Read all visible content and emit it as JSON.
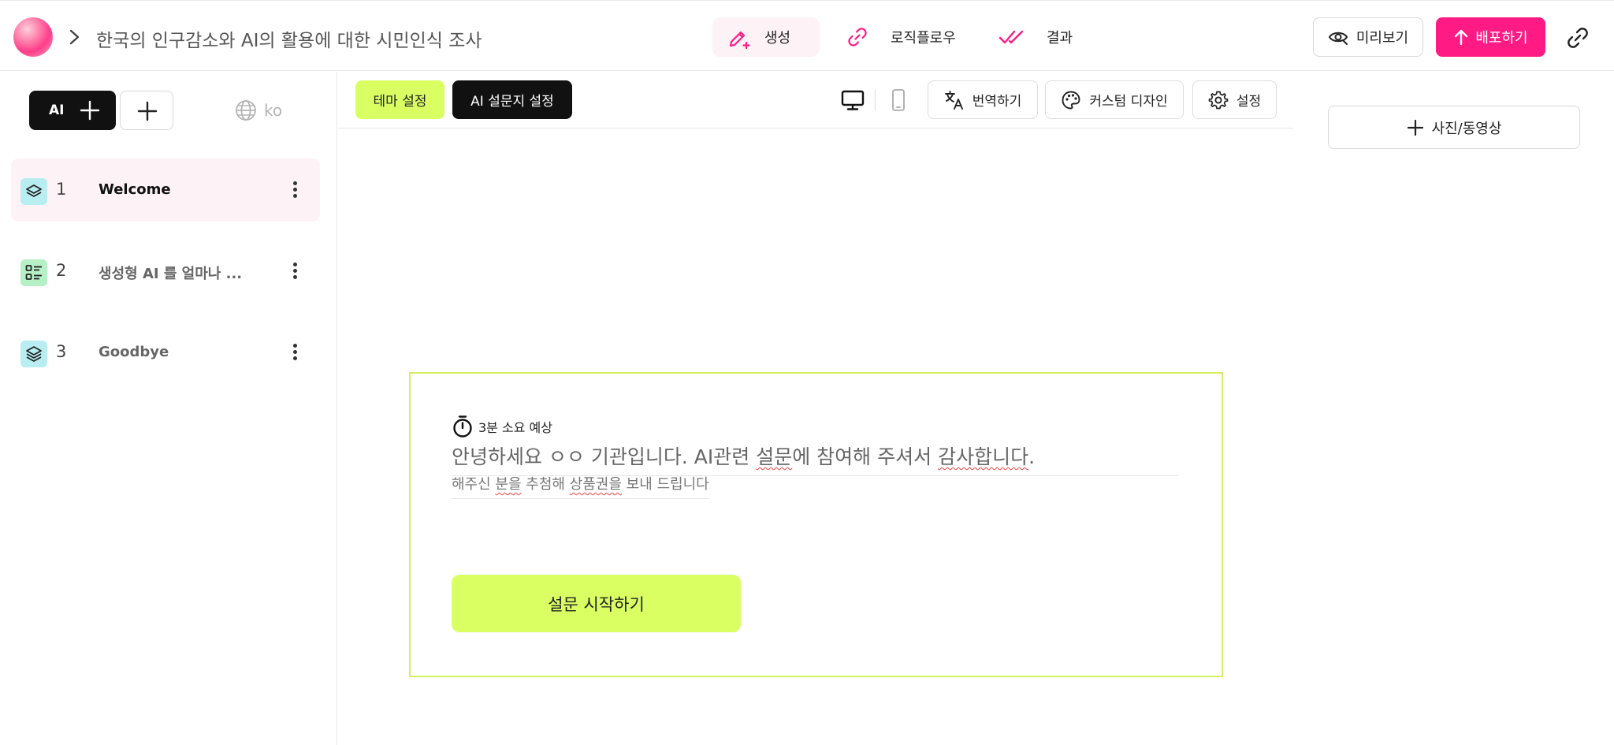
{
  "header": {
    "document_title": "한국의 인구감소와 AI의 활용에 대한 시민인식 조사",
    "tabs": [
      {
        "label": "생성",
        "icon": "pen-plus-icon",
        "active": true
      },
      {
        "label": "로직플로우",
        "icon": "link-icon",
        "active": false
      },
      {
        "label": "결과",
        "icon": "double-check-icon",
        "active": false
      }
    ],
    "preview_label": "미리보기",
    "deploy_label": "배포하기",
    "accent_color": "#ff1a84"
  },
  "sidebar": {
    "ai_add_label": "AI",
    "language": "ko",
    "pages": [
      {
        "number": "1",
        "label": "Welcome",
        "icon": "layers-icon",
        "active": true
      },
      {
        "number": "2",
        "label": "생성형 AI 를 얼마나 ...",
        "icon": "list-icon",
        "active": false
      },
      {
        "number": "3",
        "label": "Goodbye",
        "icon": "layers-stack-icon",
        "active": false
      }
    ]
  },
  "toolbar": {
    "theme_label": "테마 설정",
    "ai_settings_label": "AI 설문지 설정",
    "translate_label": "번역하기",
    "custom_design_label": "커스텀 디자인",
    "settings_label": "설정",
    "theme_color": "#d9ff63"
  },
  "canvas": {
    "estimate": "3분 소요 예상",
    "title_parts": [
      "안녕하세요 ㅇㅇ 기관입니다. AI관련 ",
      "설문",
      "에 참여해 주셔서 ",
      "감사합니다",
      "."
    ],
    "subtitle_parts": [
      "해주신 ",
      "분을",
      " 추첨해 ",
      "상품권을",
      " 보내 드립니다"
    ],
    "start_button": "설문 시작하기"
  },
  "right_panel": {
    "media_button": "사진/동영상"
  }
}
